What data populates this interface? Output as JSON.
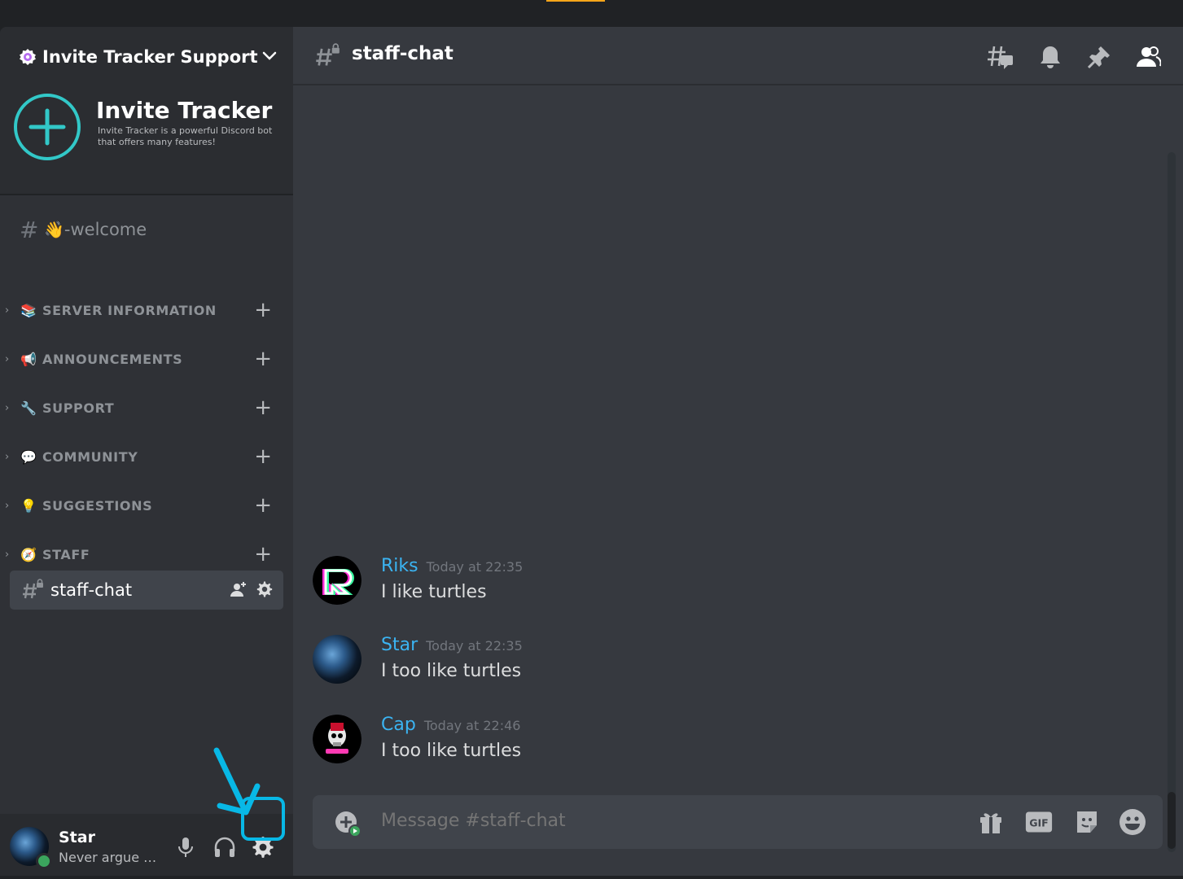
{
  "server": {
    "name": "Invite Tracker Support",
    "banner_title": "Invite Tracker",
    "banner_description": "Invite Tracker is a powerful Discord bot that offers many features!"
  },
  "channels": {
    "welcome": {
      "emoji": "👋",
      "name": "-welcome"
    },
    "categories": [
      {
        "emoji": "📚",
        "label": "SERVER INFORMATION"
      },
      {
        "emoji": "📢",
        "label": "ANNOUNCEMENTS"
      },
      {
        "emoji": "🔧",
        "label": "SUPPORT"
      },
      {
        "emoji": "💬",
        "label": "COMMUNITY"
      },
      {
        "emoji": "💡",
        "label": "SUGGESTIONS"
      },
      {
        "emoji": "🧭",
        "label": "STAFF"
      }
    ],
    "active": {
      "name": "staff-chat"
    }
  },
  "user": {
    "name": "Star",
    "status": "Never argue w..."
  },
  "main": {
    "channel_title": "staff-chat",
    "messages": [
      {
        "author": "Riks",
        "time": "Today at 22:35",
        "text": "I like turtles"
      },
      {
        "author": "Star",
        "time": "Today at 22:35",
        "text": "I too like turtles"
      },
      {
        "author": "Cap",
        "time": "Today at 22:46",
        "text": "I too like turtles"
      }
    ],
    "composer_placeholder": "Message #staff-chat",
    "gif_label": "GIF"
  },
  "colors": {
    "accent_highlight": "#08b8e6",
    "author_color": "#3bb4f2",
    "online_status": "#3ba55d"
  },
  "icons": {
    "header": [
      "threads-icon",
      "bell-icon",
      "pin-icon",
      "members-icon"
    ],
    "composer": [
      "gift-icon",
      "gif-icon",
      "sticker-icon",
      "emoji-icon"
    ],
    "user_controls": [
      "microphone-icon",
      "headphones-icon",
      "gear-icon"
    ]
  }
}
